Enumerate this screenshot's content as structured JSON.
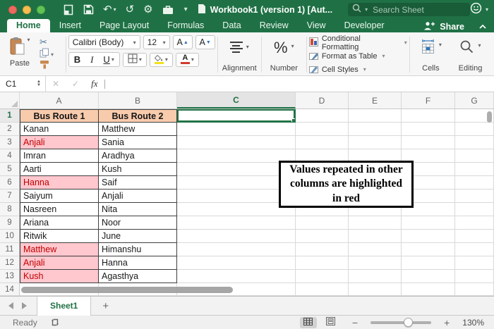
{
  "colors": {
    "excel_green": "#1F7145",
    "selection_border": "#217346",
    "header_fill": "#F8CBAD",
    "highlight_fill": "#FFC7CE",
    "highlight_text": "#C00000"
  },
  "titlebar": {
    "title": "Workbook1 (version 1) [Aut...",
    "search_placeholder": "Search Sheet"
  },
  "ribbon_tabs": {
    "items": [
      "Home",
      "Insert",
      "Page Layout",
      "Formulas",
      "Data",
      "Review",
      "View",
      "Developer"
    ],
    "active": "Home",
    "share_label": "Share"
  },
  "ribbon": {
    "paste_label": "Paste",
    "font_name": "Calibri (Body)",
    "font_size": "12",
    "grow_font_label": "A",
    "shrink_font_label": "A",
    "bold_label": "B",
    "italic_label": "I",
    "underline_label": "U",
    "alignment_label": "Alignment",
    "number_label": "Number",
    "percent_symbol": "%",
    "conditional_formatting_label": "Conditional Formatting",
    "format_as_table_label": "Format as Table",
    "cell_styles_label": "Cell Styles",
    "cells_label": "Cells",
    "editing_label": "Editing"
  },
  "formula_bar": {
    "name_box": "C1",
    "fx_label": "fx",
    "formula_value": ""
  },
  "grid": {
    "columns": [
      "A",
      "B",
      "C",
      "D",
      "E",
      "F",
      "G"
    ],
    "selected_column": "C",
    "selected_cell": "C1",
    "visible_rows": 14,
    "headers": [
      "Bus Route 1",
      "Bus Route 2"
    ],
    "data": [
      {
        "a": "Kanan",
        "b": "Matthew",
        "a_highlight": false
      },
      {
        "a": "Anjali",
        "b": "Sania",
        "a_highlight": true
      },
      {
        "a": "Imran",
        "b": "Aradhya",
        "a_highlight": false
      },
      {
        "a": "Aarti",
        "b": "Kush",
        "a_highlight": false
      },
      {
        "a": "Hanna",
        "b": "Saif",
        "a_highlight": true
      },
      {
        "a": "Saiyum",
        "b": "Anjali",
        "a_highlight": false
      },
      {
        "a": "Nasreen",
        "b": "Nita",
        "a_highlight": false
      },
      {
        "a": "Ariana",
        "b": "Noor",
        "a_highlight": false
      },
      {
        "a": "Ritwik",
        "b": "June",
        "a_highlight": false
      },
      {
        "a": "Matthew",
        "b": "Himanshu",
        "a_highlight": true
      },
      {
        "a": "Anjali",
        "b": "Hanna",
        "a_highlight": true
      },
      {
        "a": "Kush",
        "b": "Agasthya",
        "a_highlight": true
      }
    ]
  },
  "annotation": {
    "text": "Values repeated in other columns are highlighted in red"
  },
  "sheet_bar": {
    "active_tab": "Sheet1",
    "add_button": "+"
  },
  "status_bar": {
    "mode": "Ready",
    "zoom_level": "130%"
  }
}
